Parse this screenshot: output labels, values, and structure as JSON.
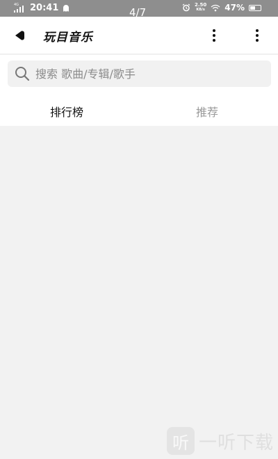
{
  "status_bar": {
    "network_tag": "4G",
    "time": "20:41",
    "image_counter": "4/7",
    "speed_value": "2.50",
    "speed_unit": "KB/s",
    "battery_percent": "47%"
  },
  "header": {
    "title": "玩目音乐"
  },
  "search": {
    "placeholder": "搜索 歌曲/专辑/歌手",
    "value": ""
  },
  "tabs": [
    {
      "label": "排行榜",
      "active": true
    },
    {
      "label": "推荐",
      "active": false
    }
  ],
  "watermark": {
    "logo_char": "听",
    "text": "一听下载"
  },
  "colors": {
    "status_bar_bg": "#8e8e8e",
    "page_bg": "#f2f2f2",
    "active_tab": "#111111",
    "inactive_tab": "#9a9a9a"
  }
}
